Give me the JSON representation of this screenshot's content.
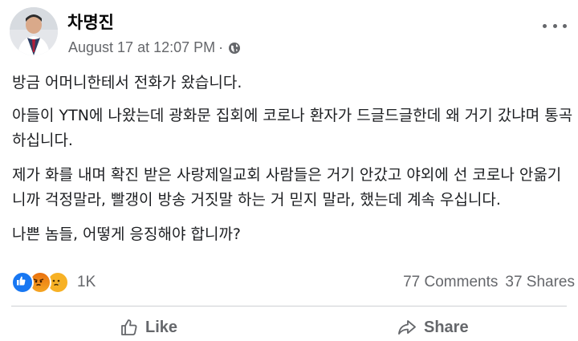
{
  "post": {
    "author": "차명진",
    "timestamp": "August 17 at 12:07 PM",
    "separator": "·",
    "paragraphs": [
      "방금 어머니한테서 전화가 왔습니다.",
      "아들이 YTN에 나왔는데 광화문 집회에 코로나 환자가 드글드글한데 왜 거기 갔냐며 통곡하십니다.",
      "제가 화를 내며 확진 받은 사랑제일교회 사람들은 거기 안갔고 야외에 선 코로나 안옮기니까 걱정말라, 빨갱이 방송 거짓말 하는 거 믿지 말라, 했는데 계속 우십니다.",
      "나쁜 놈들, 어떻게 응징해야 합니까?"
    ]
  },
  "reactions": {
    "icons": [
      "like-reaction",
      "angry-reaction",
      "sad-reaction"
    ],
    "count": "1K",
    "comments": "77 Comments",
    "shares": "37 Shares"
  },
  "actions": {
    "like_label": "Like",
    "share_label": "Share"
  },
  "colors": {
    "brand_blue": "#1877f2",
    "secondary_text": "#65676b",
    "primary_text": "#1c1e21"
  }
}
